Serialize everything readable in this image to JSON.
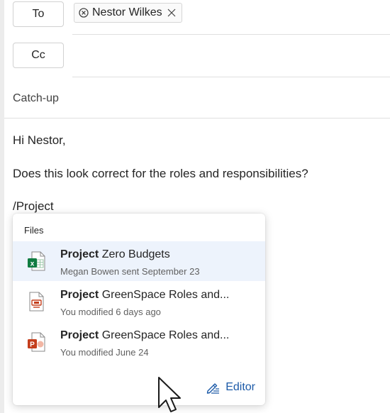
{
  "recipients": {
    "to_label": "To",
    "cc_label": "Cc",
    "to_chips": [
      {
        "name": "Nestor Wilkes"
      }
    ]
  },
  "subject": "Catch-up",
  "body": {
    "greeting": "Hi Nestor,",
    "question": "Does this look correct for the roles and responsibilities?",
    "command": "/Project"
  },
  "popup": {
    "title": "Files",
    "files": [
      {
        "match": "Project",
        "rest": " Zero Budgets",
        "meta": "Megan Bowen sent September 23",
        "icon": "excel-file-icon",
        "selected": true
      },
      {
        "match": "Project",
        "rest": " GreenSpace Roles and...",
        "meta": "You modified 6 days ago",
        "icon": "loop-file-icon",
        "selected": false
      },
      {
        "match": "Project",
        "rest": " GreenSpace Roles and...",
        "meta": "You modified June 24",
        "icon": "powerpoint-file-icon",
        "selected": false
      }
    ],
    "editor_label": "Editor"
  },
  "colors": {
    "excel": "#107c41",
    "powerpoint": "#c43e1c",
    "accent": "#1c5aa8",
    "selected_row": "#edf3fc"
  }
}
